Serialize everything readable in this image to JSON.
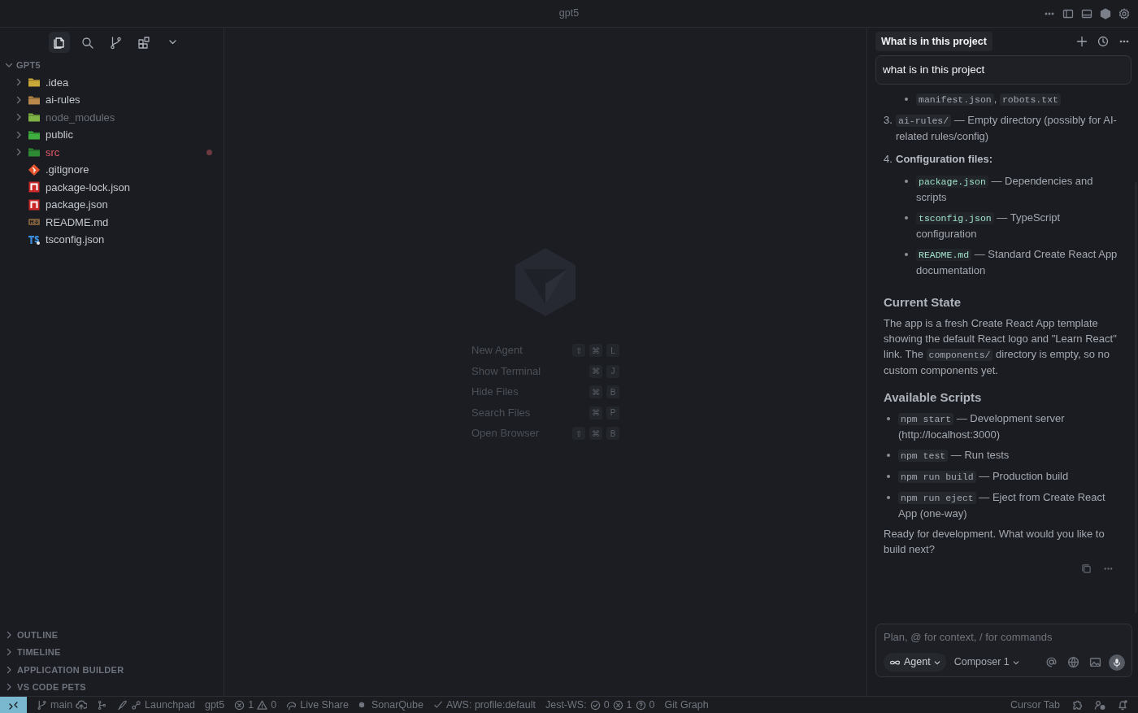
{
  "window": {
    "title": "gpt5"
  },
  "activity_bar": [
    {
      "kind": "files",
      "selected": true
    },
    {
      "kind": "search",
      "selected": false
    },
    {
      "kind": "source_control",
      "selected": false
    },
    {
      "kind": "extensions",
      "selected": false
    },
    {
      "kind": "more",
      "selected": false
    }
  ],
  "explorer": {
    "root": "GPT5",
    "expanded": true,
    "items": [
      {
        "name": ".idea",
        "kind": "folder",
        "color": "#c9a83a",
        "expanded": false
      },
      {
        "name": "ai-rules",
        "kind": "folder",
        "color": "#b8894a",
        "expanded": false
      },
      {
        "name": "node_modules",
        "kind": "folder",
        "color": "#7fb346",
        "expanded": false,
        "ignored": true
      },
      {
        "name": "public",
        "kind": "folder",
        "color": "#3fae3f",
        "expanded": false
      },
      {
        "name": "src",
        "kind": "folder",
        "color": "#2f8a35",
        "expanded": false,
        "error": true
      },
      {
        "name": ".gitignore",
        "kind": "git",
        "color": "#e4532c"
      },
      {
        "name": "package-lock.json",
        "kind": "npm",
        "color": "#cb2a2a"
      },
      {
        "name": "package.json",
        "kind": "npm",
        "color": "#cb2a2a"
      },
      {
        "name": "README.md",
        "kind": "markdown",
        "color": "#7a5c3a"
      },
      {
        "name": "tsconfig.json",
        "kind": "typescript",
        "color": "#3b8fe0"
      }
    ]
  },
  "sidebar_sections": [
    {
      "label": "OUTLINE",
      "expanded": false
    },
    {
      "label": "TIMELINE",
      "expanded": false
    },
    {
      "label": "APPLICATION BUILDER",
      "expanded": false
    },
    {
      "label": "VS CODE PETS",
      "expanded": false
    }
  ],
  "editor": {
    "shortcuts": [
      {
        "label": "New Agent",
        "keys": [
          "⇧",
          "⌘",
          "L"
        ]
      },
      {
        "label": "Show Terminal",
        "keys": [
          "⌘",
          "J"
        ]
      },
      {
        "label": "Hide Files",
        "keys": [
          "⌘",
          "B"
        ]
      },
      {
        "label": "Search Files",
        "keys": [
          "⌘",
          "P"
        ]
      },
      {
        "label": "Open Browser",
        "keys": [
          "⇧",
          "⌘",
          "B"
        ]
      }
    ]
  },
  "chat": {
    "tabs": [
      {
        "label": "What is in this project",
        "selected": true
      }
    ],
    "user_message": "what is in this project",
    "response": [
      {
        "kind": "nested_bullets",
        "items": [
          [
            {
              "kind": "code",
              "text": "manifest.json"
            },
            {
              "kind": "text",
              "text": ", "
            },
            {
              "kind": "code",
              "text": "robots.txt"
            }
          ]
        ]
      },
      {
        "kind": "numbered",
        "number": "3.",
        "parts": [
          {
            "kind": "code",
            "text": "ai-rules/"
          },
          {
            "kind": "text",
            "text": " — Empty directory (possibly for AI-related rules/config)"
          }
        ]
      },
      {
        "kind": "numbered",
        "number": "4.",
        "parts": [
          {
            "kind": "bold",
            "text": "Configuration files:"
          }
        ],
        "children": [
          [
            {
              "kind": "file",
              "text": "package.json"
            },
            {
              "kind": "text",
              "text": " — Dependencies and scripts"
            }
          ],
          [
            {
              "kind": "file",
              "text": "tsconfig.json"
            },
            {
              "kind": "text",
              "text": " — TypeScript configuration"
            }
          ],
          [
            {
              "kind": "file",
              "text": "README.md"
            },
            {
              "kind": "text",
              "text": " — Standard Create React App documentation"
            }
          ]
        ]
      },
      {
        "kind": "heading",
        "text": "Current State"
      },
      {
        "kind": "paragraph",
        "parts": [
          {
            "kind": "text",
            "text": "The app is a fresh Create React App template showing the default React logo and \"Learn React\" link. The "
          },
          {
            "kind": "code",
            "text": "components/"
          },
          {
            "kind": "text",
            "text": " directory is empty, so no custom components yet."
          }
        ]
      },
      {
        "kind": "heading",
        "text": "Available Scripts"
      },
      {
        "kind": "bullets",
        "items": [
          [
            {
              "kind": "code",
              "text": "npm start"
            },
            {
              "kind": "text",
              "text": " — Development server (http://localhost:3000)"
            }
          ],
          [
            {
              "kind": "code",
              "text": "npm test"
            },
            {
              "kind": "text",
              "text": " — Run tests"
            }
          ],
          [
            {
              "kind": "code",
              "text": "npm run build"
            },
            {
              "kind": "text",
              "text": " — Production build"
            }
          ],
          [
            {
              "kind": "code",
              "text": "npm run eject"
            },
            {
              "kind": "text",
              "text": " — Eject from Create React App (one-way)"
            }
          ]
        ]
      },
      {
        "kind": "paragraph",
        "parts": [
          {
            "kind": "text",
            "text": "Ready for development. What would you like to build next?"
          }
        ]
      }
    ],
    "composer": {
      "placeholder": "Plan, @ for context, / for commands",
      "mode": "Agent",
      "model": "Composer 1"
    }
  },
  "status_bar": {
    "left": [
      {
        "kind": "branch",
        "text": "main"
      },
      {
        "kind": "graph"
      },
      {
        "kind": "launchpad",
        "text": "Launchpad"
      },
      {
        "kind": "plain",
        "text": "gpt5"
      },
      {
        "kind": "problems",
        "errors": "1",
        "warnings": "0"
      },
      {
        "kind": "liveshare",
        "text": "Live Share"
      },
      {
        "kind": "sonar",
        "text": "SonarQube"
      },
      {
        "kind": "check",
        "text": "AWS: profile:default"
      },
      {
        "kind": "jest",
        "text": "Jest-WS:",
        "passed": "0",
        "failed": "1",
        "unknown": "0"
      },
      {
        "kind": "plain",
        "text": "Git Graph"
      }
    ],
    "right": [
      {
        "kind": "plain",
        "text": "Cursor Tab"
      },
      {
        "kind": "copilot"
      },
      {
        "kind": "accounts"
      },
      {
        "kind": "bell"
      }
    ]
  }
}
